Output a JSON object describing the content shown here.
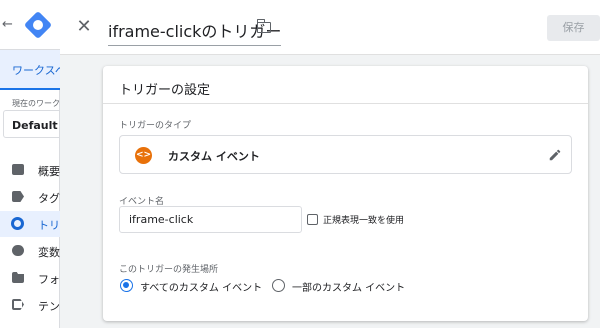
{
  "app": {
    "back_glyph": "←",
    "sidebar": {
      "workspace_tab": "ワークスペ",
      "workspace_label": "現在のワーク",
      "workspace_name": "Default Wo",
      "items": [
        {
          "label": "概要",
          "icon": "overview-icon"
        },
        {
          "label": "タグ",
          "icon": "tag-icon"
        },
        {
          "label": "トリガ",
          "icon": "trigger-icon",
          "active": true
        },
        {
          "label": "変数",
          "icon": "variable-icon"
        },
        {
          "label": "フォル",
          "icon": "folder-icon"
        },
        {
          "label": "テンプ",
          "icon": "template-icon"
        }
      ]
    }
  },
  "panel": {
    "close_glyph": "✕",
    "title": "iframe-clickのトリガー",
    "save_label": "保存",
    "card": {
      "title": "トリガーの設定",
      "type_label": "トリガーのタイプ",
      "type_icon_glyph": "<>",
      "type_name": "カスタム イベント",
      "event_name_label": "イベント名",
      "event_name_value": "iframe-click",
      "regex_label": "正規表現一致を使用",
      "regex_checked": false,
      "occurrence_label": "このトリガーの発生場所",
      "options": [
        {
          "label": "すべてのカスタム イベント",
          "selected": true
        },
        {
          "label": "一部のカスタム イベント",
          "selected": false
        }
      ]
    }
  },
  "colors": {
    "accent": "#1a73e8",
    "trigger_type_icon": "#e8710a",
    "active_nav_bg": "#e8f0fe"
  }
}
